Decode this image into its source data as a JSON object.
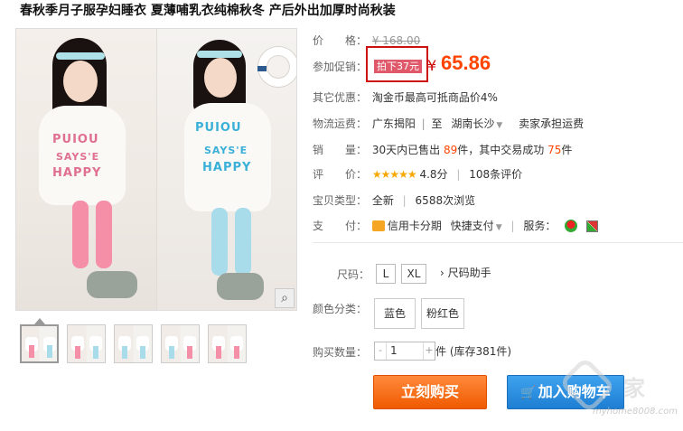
{
  "title": "春秋季月子服孕妇睡衣 夏薄哺乳衣纯棉秋冬 产后外出加厚时尚秋装",
  "images": {
    "shirt_text_1": "PUIOU",
    "shirt_text_2": "SAYS'E",
    "shirt_text_3": "HAPPY",
    "zoom_icon": "magnifier-icon",
    "thumbnails": [
      "thumb-1",
      "thumb-2",
      "thumb-3",
      "thumb-4",
      "thumb-5"
    ]
  },
  "info": {
    "price_label": "价　　格：",
    "original_price": "¥ 168.00",
    "promo_label": "参加促销：",
    "promo_tag": "拍下37元",
    "currency": "¥",
    "promo_price": "65.86",
    "other_label": "其它优惠：",
    "other_value": "淘金币最高可抵商品价4%",
    "shipping_label": "物流运费：",
    "ship_from": "广东揭阳",
    "ship_to_prefix": "至",
    "ship_to": "湖南长沙",
    "ship_fee": "卖家承担运费",
    "sales_label": "销　　量：",
    "sales_prefix": "30天内已售出",
    "sales_count": "89",
    "sales_mid": "件，其中交易成功",
    "sales_success": "75",
    "sales_suffix": "件",
    "rating_label": "评　　价：",
    "rating_stars": "★★★★★",
    "rating_score": "4.8分",
    "rating_count": "108条评价",
    "type_label": "宝贝类型：",
    "type_value": "全新",
    "views": "6588次浏览",
    "pay_label": "支　　付：",
    "pay_credit": "信用卡分期",
    "pay_fast": "快捷支付",
    "service_label": "服务："
  },
  "options": {
    "size_label": "尺码：",
    "sizes": [
      "L",
      "XL"
    ],
    "size_help": "› 尺码助手",
    "color_label": "颜色分类：",
    "colors": [
      "蓝色",
      "粉红色"
    ],
    "qty_label": "购买数量：",
    "qty_value": "1",
    "qty_minus": "-",
    "qty_plus": "+",
    "stock": "件 (库存381件)"
  },
  "actions": {
    "buy_now": "立刻购买",
    "add_to_cart": "加入购物车"
  },
  "watermark": {
    "word": "家",
    "url": "myhome8008.com"
  },
  "colors": {
    "price": "#ff4400",
    "buy": "#f05a00",
    "cart": "#1e7fd3",
    "promo_tag": "#e0596b"
  }
}
